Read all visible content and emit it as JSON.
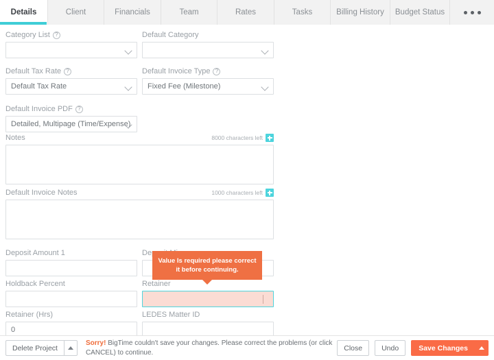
{
  "tabs": [
    {
      "label": "Details",
      "active": true
    },
    {
      "label": "Client",
      "active": false
    },
    {
      "label": "Financials",
      "active": false
    },
    {
      "label": "Team",
      "active": false
    },
    {
      "label": "Rates",
      "active": false
    },
    {
      "label": "Tasks",
      "active": false
    },
    {
      "label": "Billing History",
      "active": false
    },
    {
      "label": "Budget Status",
      "active": false
    }
  ],
  "overflow_tab": {
    "icon": "ellipsis-icon"
  },
  "form": {
    "category_list": {
      "label": "Category List",
      "help": "?",
      "value": "",
      "placeholder": ""
    },
    "default_category": {
      "label": "Default Category",
      "value": "",
      "placeholder": ""
    },
    "default_tax_rate": {
      "label": "Default Tax Rate",
      "help": "?",
      "value": "Default Tax Rate"
    },
    "default_invoice_type": {
      "label": "Default Invoice Type",
      "help": "?",
      "value": "Fixed Fee (Milestone)"
    },
    "default_invoice_pdf": {
      "label": "Default Invoice PDF",
      "help": "?",
      "value": "Detailed, Multipage (Time/Expense)"
    },
    "notes": {
      "label": "Notes",
      "chars_left": "8000 characters left",
      "value": ""
    },
    "default_invoice_notes": {
      "label": "Default Invoice Notes",
      "chars_left": "1000 characters left",
      "value": ""
    },
    "deposit_amount_1": {
      "label": "Deposit Amount 1",
      "value": ""
    },
    "deposit_min": {
      "label": "Deposit Min",
      "value": ""
    },
    "holdback_percent": {
      "label": "Holdback Percent",
      "value": ""
    },
    "retainer": {
      "label": "Retainer",
      "value": "",
      "state": "error"
    },
    "retainer_hrs": {
      "label": "Retainer (Hrs)",
      "value": "0"
    },
    "ledes_matter_id": {
      "label": "LEDES Matter ID",
      "value": ""
    }
  },
  "tooltip": {
    "text": "Value Is required please correct it before continuing."
  },
  "footer": {
    "delete_project": "Delete Project",
    "error_prefix": "Sorry!",
    "error_text": "BigTime couldn't save your changes. Please correct the problems (or click CANCEL) to continue.",
    "close": "Close",
    "undo": "Undo",
    "save_changes": "Save Changes"
  },
  "colors": {
    "accent_teal": "#3fcdd6",
    "plus_teal": "#4dd4dd",
    "error_orange": "#ef7043",
    "primary_orange": "#fa6b46",
    "tab_bg": "#f2f2f2",
    "label_gray": "#9aa0a6"
  }
}
